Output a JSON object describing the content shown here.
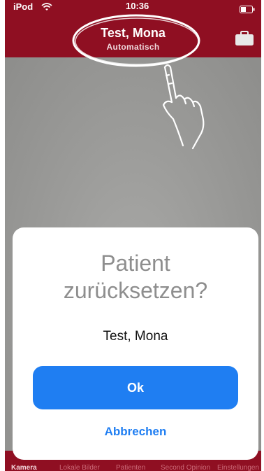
{
  "status_bar": {
    "carrier": "iPod",
    "time": "10:36"
  },
  "header": {
    "patient_name": "Test, Mona",
    "mode": "Automatisch"
  },
  "dialog": {
    "title_line1": "Patient",
    "title_line2": "zurücksetzen?",
    "message": "Test, Mona",
    "ok_label": "Ok",
    "cancel_label": "Abbrechen"
  },
  "tabbar": {
    "items": [
      {
        "label": "Kamera",
        "icon": "camera-icon",
        "active": true
      },
      {
        "label": "Lokale Bilder",
        "icon": "images-icon",
        "active": false
      },
      {
        "label": "Patienten",
        "icon": "patients-icon",
        "active": false
      },
      {
        "label": "Second Opinion",
        "icon": "second-opinion-icon",
        "active": false
      },
      {
        "label": "Einstellungen",
        "icon": "settings-icon",
        "active": false
      }
    ]
  },
  "colors": {
    "brand_red": "#8f0f22",
    "accent_blue": "#1f7ef2",
    "title_gray": "#8e8e8e"
  }
}
